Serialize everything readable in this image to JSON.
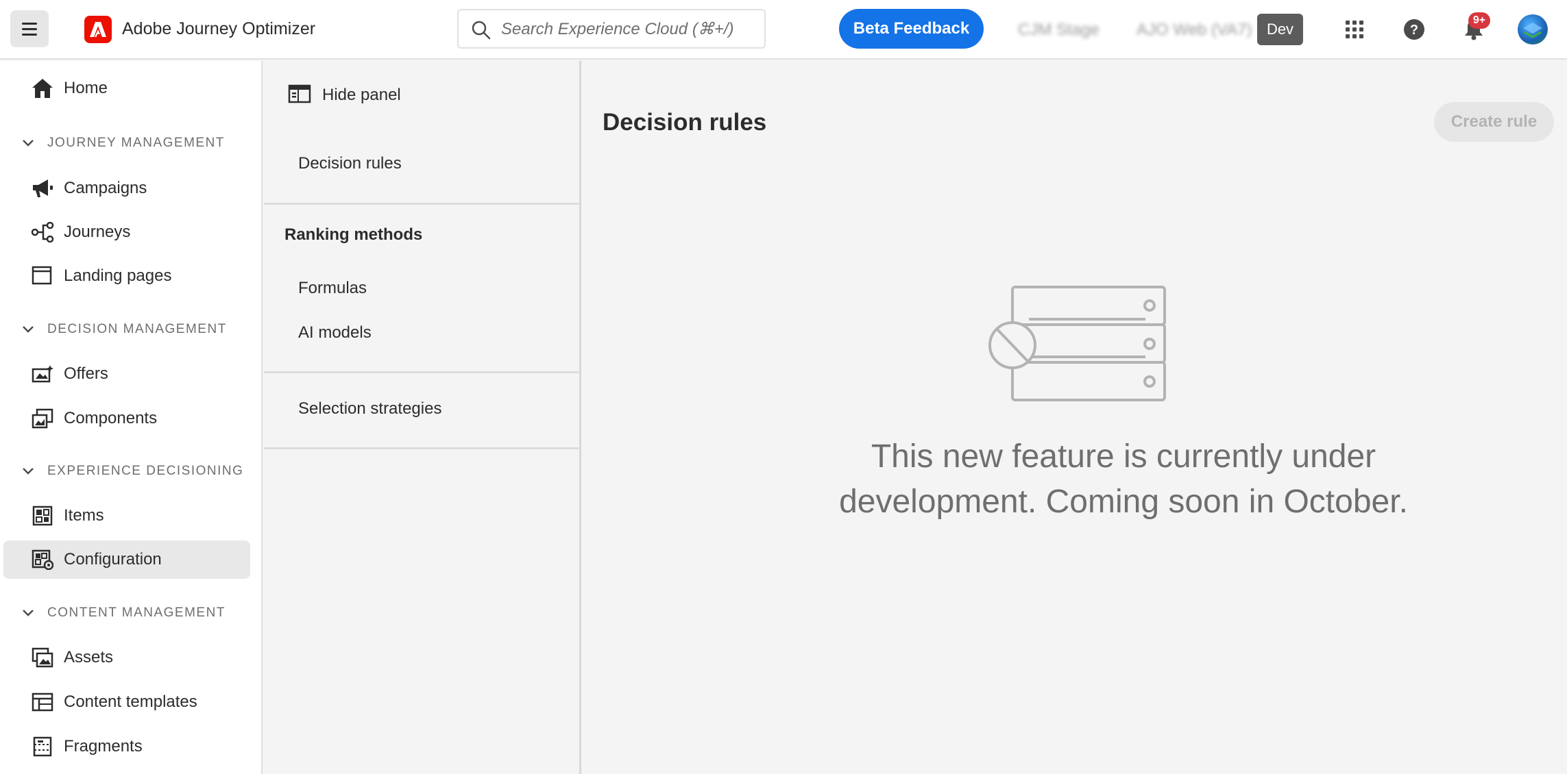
{
  "header": {
    "app_title": "Adobe Journey Optimizer",
    "search_placeholder": "Search Experience Cloud (⌘+/)",
    "beta_feedback_label": "Beta Feedback",
    "org_label_blurred": "CJM Stage",
    "sandbox_label_blurred": "AJO Web (VA7)",
    "env_badge": "Dev",
    "notification_count": "9+",
    "icons": [
      "menu-icon",
      "adobe-logo-icon",
      "search-icon",
      "app-switcher-icon",
      "help-icon",
      "bell-icon",
      "avatar"
    ],
    "colors": {
      "brand": "#eb1000",
      "accent": "#1473e6",
      "badge": "#d7373f"
    }
  },
  "sidebar": {
    "home": "Home",
    "sections": [
      {
        "label": "JOURNEY MANAGEMENT",
        "items": [
          "Campaigns",
          "Journeys",
          "Landing pages"
        ]
      },
      {
        "label": "DECISION MANAGEMENT",
        "items": [
          "Offers",
          "Components"
        ]
      },
      {
        "label": "EXPERIENCE DECISIONING",
        "items": [
          "Items",
          "Configuration"
        ]
      },
      {
        "label": "CONTENT MANAGEMENT",
        "items": [
          "Assets",
          "Content templates",
          "Fragments"
        ]
      }
    ],
    "active_item": "Configuration"
  },
  "panel": {
    "hide_panel_label": "Hide panel",
    "decision_rules": "Decision rules",
    "ranking_heading": "Ranking methods",
    "formulas": "Formulas",
    "ai_models": "AI models",
    "selection_strategies": "Selection strategies"
  },
  "main": {
    "title": "Decision rules",
    "create_button": "Create rule",
    "empty_message_line1": "This new feature is currently under",
    "empty_message_line2": "development. Coming soon in October."
  }
}
